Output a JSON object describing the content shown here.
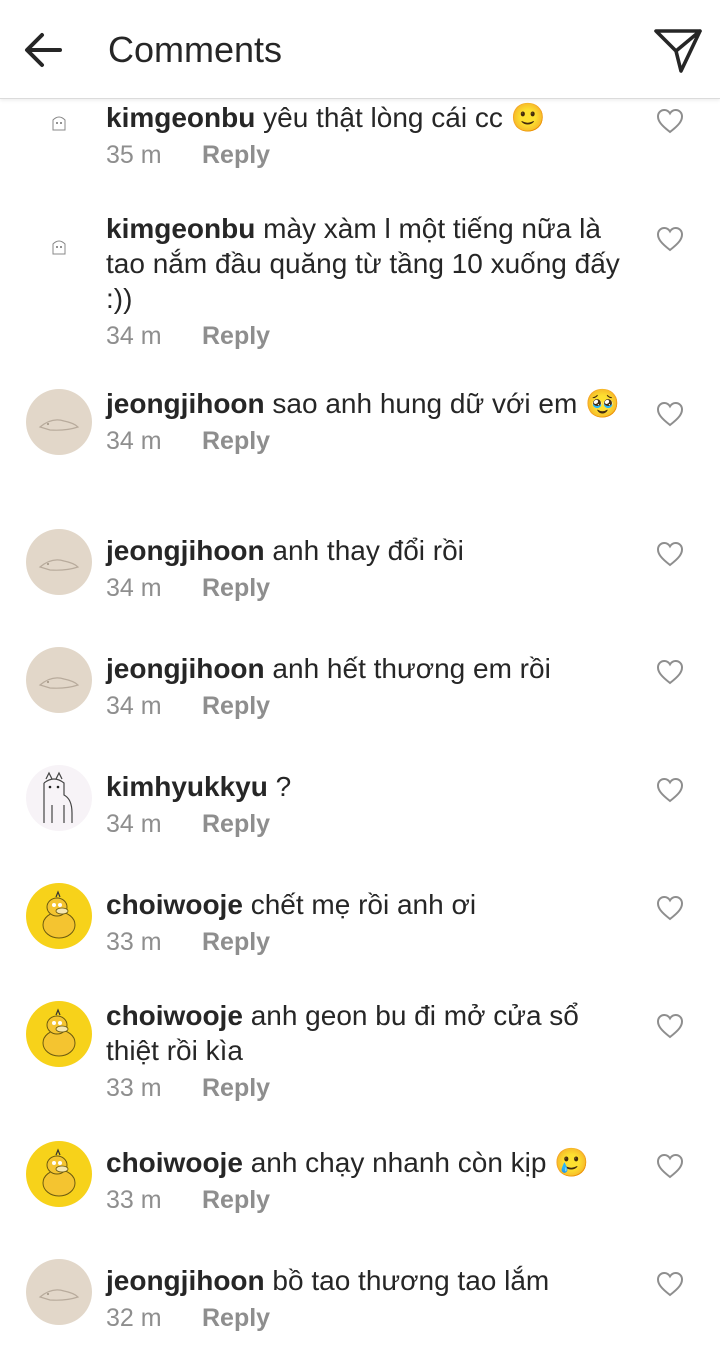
{
  "header": {
    "title": "Comments",
    "back_icon": "arrow-left-icon",
    "send_icon": "paper-plane-icon"
  },
  "colors": {
    "text": "#262626",
    "muted": "#8e8e8e",
    "divider": "#dbdbdb",
    "avatar_beige": "#e2d7c9",
    "avatar_yellow": "#f7d21a"
  },
  "reply_label": "Reply",
  "comments": [
    {
      "username": "kimgeonbu",
      "text": "yêu thật lòng cái cc 🙂",
      "time": "35 m",
      "avatar": "tiny-sketch"
    },
    {
      "username": "kimgeonbu",
      "text": "mày xàm l một tiếng nữa là tao nắm đầu quăng từ tầng 10 xuống đấy :))",
      "time": "34 m",
      "avatar": "tiny-sketch"
    },
    {
      "username": "jeongjihoon",
      "text": "sao anh hung dữ với em 🥹",
      "time": "34 m",
      "avatar": "beige-sketch"
    },
    {
      "username": "jeongjihoon",
      "text": "anh thay đổi rồi",
      "time": "34 m",
      "avatar": "beige-sketch"
    },
    {
      "username": "jeongjihoon",
      "text": "anh hết thương em rồi",
      "time": "34 m",
      "avatar": "beige-sketch"
    },
    {
      "username": "kimhyukkyu",
      "text": "?",
      "time": "34 m",
      "avatar": "alpaca"
    },
    {
      "username": "choiwooje",
      "text": "chết mẹ rồi anh ơi",
      "time": "33 m",
      "avatar": "yellow-duck"
    },
    {
      "username": "choiwooje",
      "text": "anh geon bu đi mở cửa sổ thiệt rồi kìa",
      "time": "33 m",
      "avatar": "yellow-duck"
    },
    {
      "username": "choiwooje",
      "text": "anh chạy nhanh còn kịp 🥲",
      "time": "33 m",
      "avatar": "yellow-duck"
    },
    {
      "username": "jeongjihoon",
      "text": "bồ tao thương tao lắm",
      "time": "32 m",
      "avatar": "beige-sketch"
    }
  ]
}
